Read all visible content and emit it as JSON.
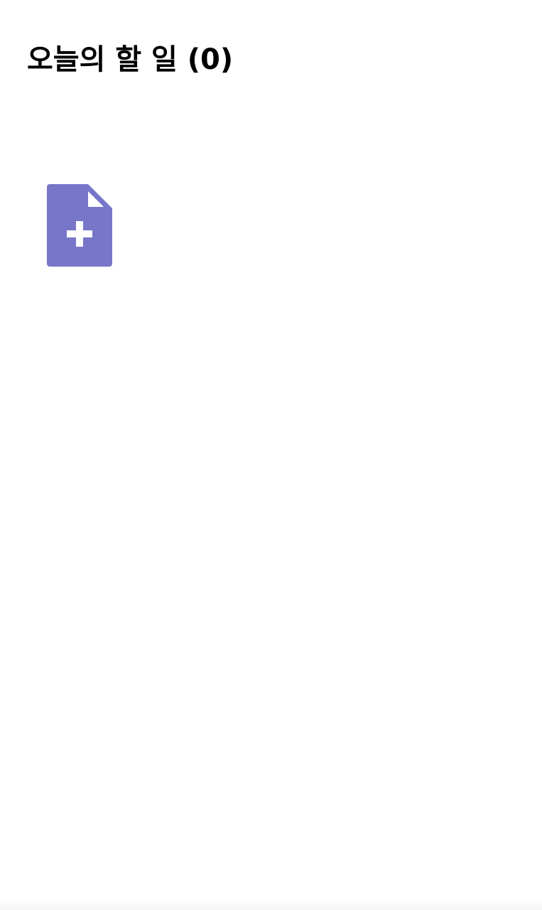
{
  "header": {
    "title": "오늘의 할 일 (0)"
  },
  "actions": {
    "add_task_icon": "file-add-icon"
  },
  "colors": {
    "background": "#ffffff",
    "title_text": "#000000",
    "accent": "#7876c8",
    "icon_detail": "#ffffff"
  }
}
